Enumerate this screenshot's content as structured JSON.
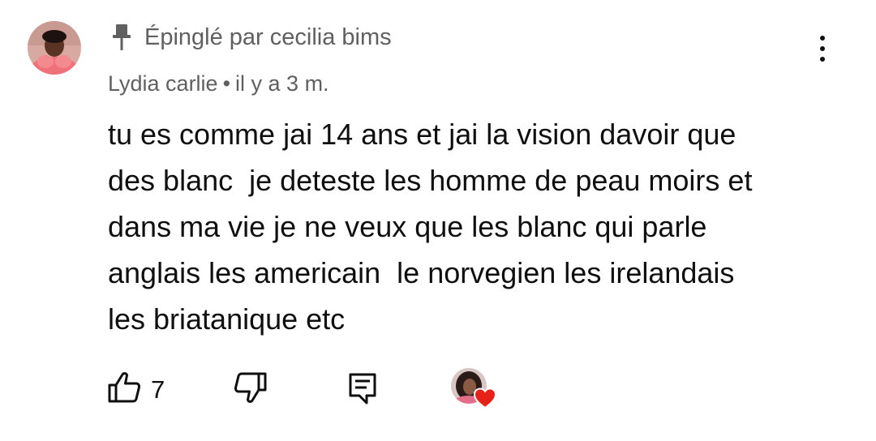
{
  "comment": {
    "pinned_text": "Épinglé par cecilia bims",
    "author": "Lydia carlie",
    "separator": "•",
    "time": "il y a 3 m.",
    "body_lines": [
      "tu es comme jai 14 ans et jai la vision davoir que",
      "des blanc  je deteste les homme de peau moirs et",
      "dans ma vie je ne veux que les blanc qui parle",
      "anglais les americain  le norvegien les irelandais",
      "les briatanique etc"
    ],
    "like_count": "7"
  },
  "icons": {
    "pin": "pin-icon",
    "menu": "more-vertical-icon",
    "like": "thumbs-up-icon",
    "dislike": "thumbs-down-icon",
    "reply": "reply-comment-icon",
    "heart": "heart-icon"
  },
  "colors": {
    "text_primary": "#0f0f0f",
    "text_secondary": "#606060",
    "heart": "#e62117"
  }
}
